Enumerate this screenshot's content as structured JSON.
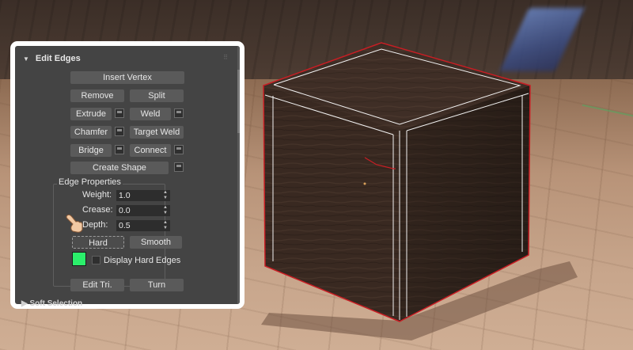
{
  "panel": {
    "rollout_title": "Edit Edges",
    "buttons": {
      "insert_vertex": "Insert Vertex",
      "remove": "Remove",
      "split": "Split",
      "extrude": "Extrude",
      "weld": "Weld",
      "chamfer": "Chamfer",
      "target_weld": "Target Weld",
      "bridge": "Bridge",
      "connect": "Connect",
      "create_shape": "Create Shape",
      "hard": "Hard",
      "smooth": "Smooth",
      "edit_tri": "Edit Tri.",
      "turn": "Turn"
    },
    "edge_properties": {
      "title": "Edge Properties",
      "weight_label": "Weight:",
      "weight_value": "1.0",
      "crease_label": "Crease:",
      "crease_value": "0.0",
      "depth_label": "Depth:",
      "depth_value": "0.5",
      "display_hard_edges_label": "Display Hard Edges",
      "display_hard_edges_checked": false,
      "hard_edge_color": "#2bef6b"
    },
    "next_rollout_title": "Soft Selection"
  },
  "viewport": {
    "object": "wooden cube",
    "selection_color": "#c81e24",
    "edge_color": "#ffffff"
  },
  "icons": [
    "expand-triangle-icon",
    "settings-box-icon",
    "hand-pointer-icon"
  ]
}
